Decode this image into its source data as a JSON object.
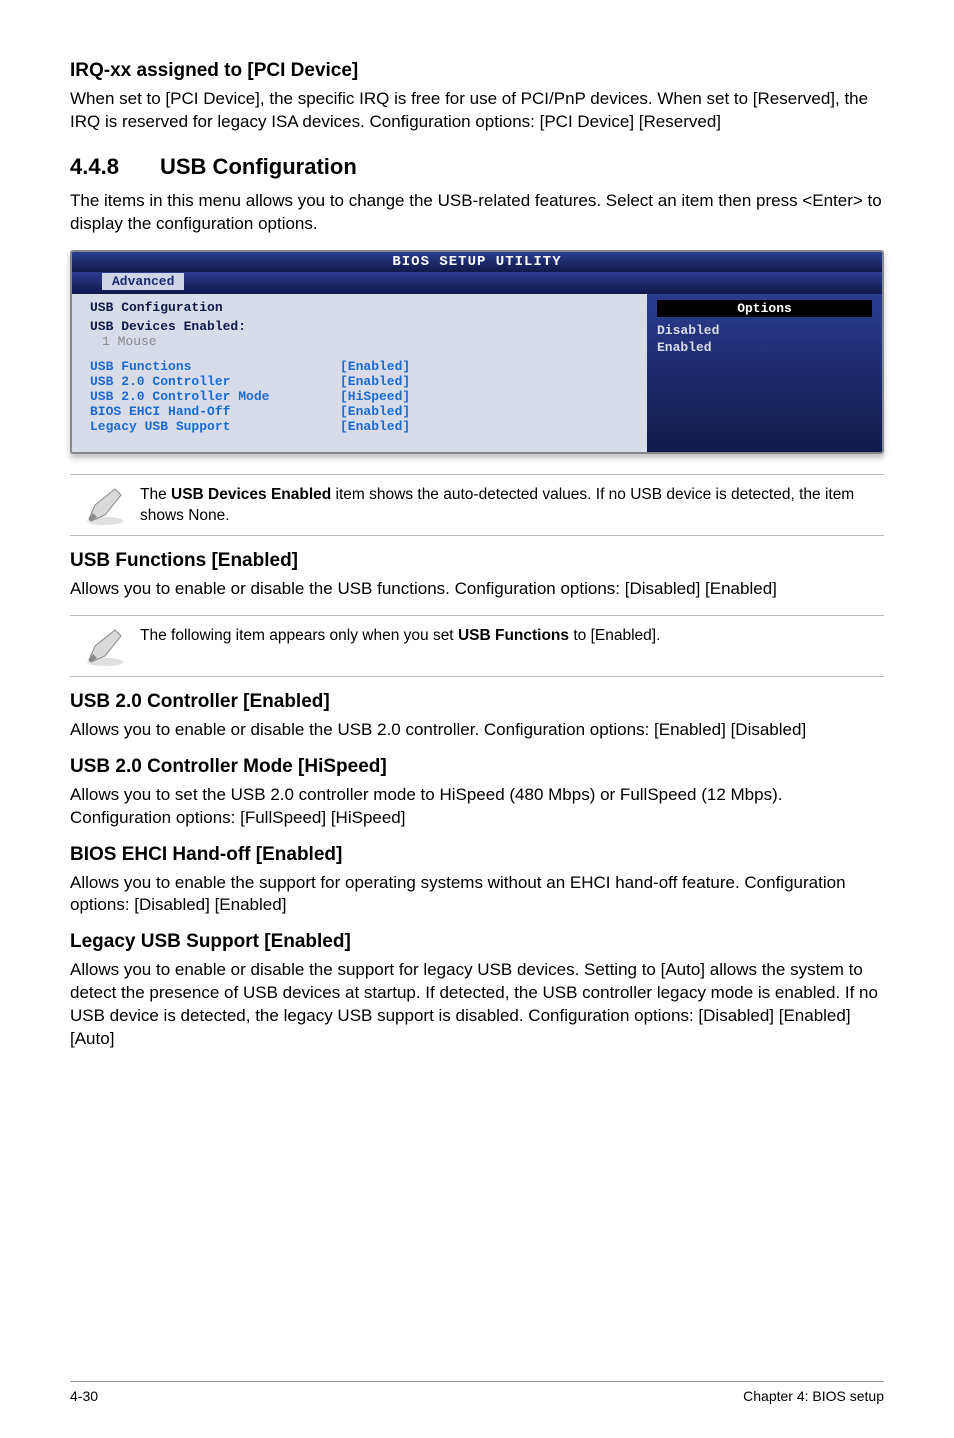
{
  "section_irq": {
    "heading": "IRQ-xx assigned to [PCI Device]",
    "body": "When set to [PCI Device], the specific IRQ is free for use of PCI/PnP devices. When set to [Reserved], the IRQ is reserved for legacy ISA devices. Configuration options: [PCI Device] [Reserved]"
  },
  "section_usb": {
    "number": "4.4.8",
    "title": "USB Configuration",
    "intro": "The items in this menu allows you to change the USB-related features. Select an item then press <Enter> to display the configuration options."
  },
  "bios": {
    "top": "BIOS SETUP UTILITY",
    "tab": "Advanced",
    "panel_title": "USB Configuration",
    "devices_label": "USB Devices Enabled:",
    "devices_value": "1 Mouse",
    "items": [
      {
        "label": "USB Functions",
        "value": "[Enabled]"
      },
      {
        "label": "USB 2.0 Controller",
        "value": "[Enabled]"
      },
      {
        "label": "USB 2.0 Controller Mode",
        "value": "[HiSpeed]"
      },
      {
        "label": "BIOS EHCI Hand-Off",
        "value": "[Enabled]"
      },
      {
        "label": "Legacy USB Support",
        "value": "[Enabled]"
      }
    ],
    "options_header": "Options",
    "options": [
      "Disabled",
      "Enabled"
    ]
  },
  "note1": {
    "prefix": "The ",
    "bold": "USB Devices Enabled",
    "suffix": " item shows the auto-detected values. If no USB device is detected, the item shows None."
  },
  "usb_functions": {
    "heading": "USB Functions [Enabled]",
    "body": "Allows you to enable or disable the USB functions. Configuration options: [Disabled] [Enabled]"
  },
  "note2": {
    "prefix": "The following item appears only when you set ",
    "bold": "USB Functions",
    "suffix": " to [Enabled]."
  },
  "usb20_controller": {
    "heading": "USB 2.0 Controller [Enabled]",
    "body": "Allows you to enable or disable the USB 2.0 controller. Configuration options: [Enabled] [Disabled]"
  },
  "usb20_mode": {
    "heading": "USB 2.0 Controller Mode [HiSpeed]",
    "body": "Allows you to set the USB 2.0 controller mode to HiSpeed (480 Mbps) or FullSpeed (12 Mbps). Configuration options: [FullSpeed] [HiSpeed]"
  },
  "ehci": {
    "heading": "BIOS EHCI Hand-off [Enabled]",
    "body": "Allows you to enable the support for operating systems without an EHCI hand-off feature. Configuration options: [Disabled] [Enabled]"
  },
  "legacy": {
    "heading": "Legacy USB Support [Enabled]",
    "body": "Allows you to enable or disable the support for legacy USB devices. Setting to [Auto] allows the system to detect the presence of USB devices at startup. If detected, the USB controller legacy mode is enabled. If no USB device is detected, the legacy USB support is disabled. Configuration options: [Disabled] [Enabled] [Auto]"
  },
  "footer": {
    "left": "4-30",
    "right": "Chapter 4: BIOS setup"
  },
  "icons": {
    "pencil": "pencil-icon"
  }
}
